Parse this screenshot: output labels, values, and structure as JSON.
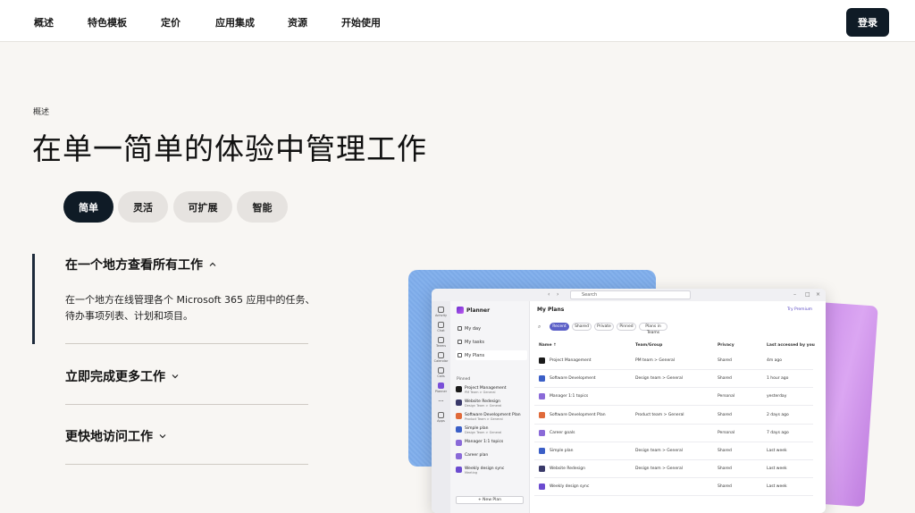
{
  "nav": {
    "items": [
      "概述",
      "特色模板",
      "定价",
      "应用集成",
      "资源",
      "开始使用"
    ],
    "login": "登录"
  },
  "hero": {
    "eyebrow": "概述",
    "title": "在单一简单的体验中管理工作"
  },
  "pills": [
    "简单",
    "灵活",
    "可扩展",
    "智能"
  ],
  "accordion": [
    {
      "title": "在一个地方查看所有工作",
      "expanded": true,
      "body": "在一个地方在线管理各个 Microsoft 365 应用中的任务、待办事项列表、计划和项目。"
    },
    {
      "title": "立即完成更多工作",
      "expanded": false
    },
    {
      "title": "更快地访问工作",
      "expanded": false
    }
  ],
  "app": {
    "search_placeholder": "Search",
    "brand": "Planner",
    "rail": [
      "Activity",
      "Chat",
      "Teams",
      "Calendar",
      "Calls",
      "Planner",
      "•••",
      "Apps"
    ],
    "sidebar": [
      "My day",
      "My tasks",
      "My Plans"
    ],
    "pinned_label": "Pinned",
    "plans": [
      {
        "name": "Project Management",
        "sub": "PM Team > General",
        "color": "#1a1a1a"
      },
      {
        "name": "Website Redesign",
        "sub": "Design Team > General",
        "color": "#3a3a6a"
      },
      {
        "name": "Software Development Plan",
        "sub": "Product Team > General",
        "color": "#e06a3a"
      },
      {
        "name": "Simple plan",
        "sub": "Design Team > General",
        "color": "#3b5fc7"
      },
      {
        "name": "Manager 1:1 topics",
        "sub": "",
        "color": "#8a6ad8"
      },
      {
        "name": "Career plan",
        "sub": "",
        "color": "#8a6ad8"
      },
      {
        "name": "Weekly design sync",
        "sub": "Meeting",
        "color": "#6b4bd0"
      }
    ],
    "new_plan": "+ New Plan",
    "main_title": "My Plans",
    "premium": "Try Premium",
    "filters": [
      "Recent",
      "Shared",
      "Private",
      "Pinned",
      "Plans in Teams"
    ],
    "columns": [
      "Name ↑",
      "Team/Group",
      "Privacy",
      "Last accessed by you"
    ],
    "rows": [
      {
        "name": "Project Management",
        "team": "PM team > General",
        "privacy": "Shared",
        "last": "4m ago",
        "color": "#1a1a1a"
      },
      {
        "name": "Software Development",
        "team": "Design team > General",
        "privacy": "Shared",
        "last": "1 hour ago",
        "color": "#3b5fc7"
      },
      {
        "name": "Manager 1:1 topics",
        "team": "",
        "privacy": "Personal",
        "last": "yesterday",
        "color": "#8a6ad8"
      },
      {
        "name": "Software Development Plan",
        "team": "Product team > General",
        "privacy": "Shared",
        "last": "2 days ago",
        "color": "#e06a3a"
      },
      {
        "name": "Career goals",
        "team": "",
        "privacy": "Personal",
        "last": "7 days ago",
        "color": "#8a6ad8"
      },
      {
        "name": "Simple plan",
        "team": "Design team > General",
        "privacy": "Shared",
        "last": "Last week",
        "color": "#3b5fc7"
      },
      {
        "name": "Website Redesign",
        "team": "Design team > General",
        "privacy": "Shared",
        "last": "Last week",
        "color": "#3a3a6a"
      },
      {
        "name": "Weekly design sync",
        "team": "",
        "privacy": "Shared",
        "last": "Last week",
        "color": "#6b4bd0"
      }
    ]
  }
}
